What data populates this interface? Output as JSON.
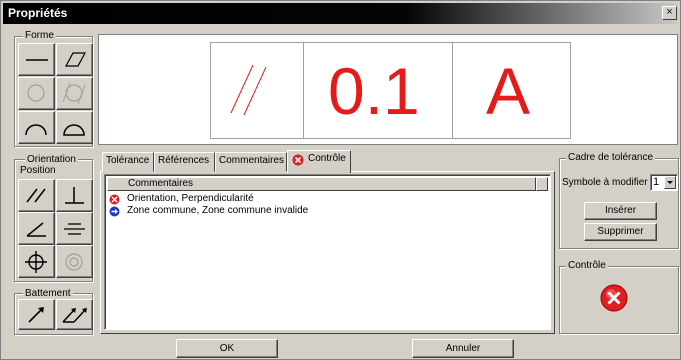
{
  "window": {
    "title": "Propriétés",
    "close_glyph": "×"
  },
  "left_panel": {
    "forme": {
      "legend": "Forme"
    },
    "orientation": {
      "legend_line1": "Orientation",
      "legend_line2": "Position"
    },
    "battement": {
      "legend": "Battement"
    }
  },
  "preview": {
    "tolerance_value": "0.1",
    "reference": "A",
    "symbol_icon": "parallelism-icon"
  },
  "tabs": [
    {
      "label": "Tolérance",
      "active": false
    },
    {
      "label": "Références",
      "active": false
    },
    {
      "label": "Commentaires",
      "active": false
    },
    {
      "label": "Contrôle",
      "active": true,
      "icon": "error-icon"
    }
  ],
  "comments_list": {
    "header": "Commentaires",
    "rows": [
      {
        "icon": "error-icon",
        "text": "Orientation, Perpendicularité"
      },
      {
        "icon": "info-arrow-icon",
        "text": "Zone commune, Zone commune invalide"
      }
    ]
  },
  "tolerance_frame": {
    "legend": "Cadre de tolérance",
    "symbol_label": "Symbole à modifier >",
    "symbol_value": "1",
    "insert_label": "Insérer",
    "delete_label": "Supprimer"
  },
  "control": {
    "legend": "Contrôle",
    "status_icon": "error-icon"
  },
  "footer": {
    "ok_label": "OK",
    "cancel_label": "Annuler"
  },
  "colors": {
    "accent_red": "#e31b1b",
    "face": "#d4d0c8"
  }
}
